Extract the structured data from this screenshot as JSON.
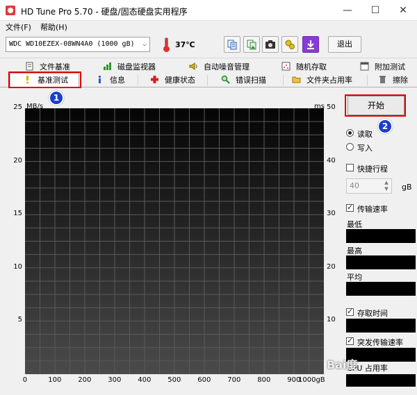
{
  "window": {
    "title": "HD Tune Pro 5.70 - 硬盘/固态硬盘实用程序",
    "minimize": "—",
    "maximize": "☐",
    "close": "✕"
  },
  "menu": {
    "file": "文件(F)",
    "help": "帮助(H)"
  },
  "toolbar": {
    "drive": "WDC WD10EZEX-08WN4A0 (1000 gB)",
    "temperature": "37℃",
    "exit_label": "退出",
    "buttons": [
      "copy-text-icon",
      "copy-image-icon",
      "screenshot-icon",
      "options-icon",
      "download-icon"
    ]
  },
  "tabs": {
    "row1": [
      "文件基准",
      "磁盘监视器",
      "自动噪音管理",
      "随机存取",
      "附加测试"
    ],
    "row2": [
      "基准测试",
      "信息",
      "健康状态",
      "错误扫描",
      "文件夹占用率",
      "擦除"
    ],
    "active": "基准测试"
  },
  "chart_data": {
    "type": "line",
    "ylabel_left": "MB/s",
    "ylabel_right": "ms",
    "xlabel_unit": "gB",
    "ylim_left": [
      0,
      25
    ],
    "ylim_right": [
      0,
      50
    ],
    "xlim": [
      0,
      1000
    ],
    "y_ticks_left": [
      "25",
      "20",
      "15",
      "10",
      "5"
    ],
    "y_ticks_right": [
      "50",
      "40",
      "30",
      "20",
      "10"
    ],
    "x_ticks": [
      "0",
      "100",
      "200",
      "300",
      "400",
      "500",
      "600",
      "700",
      "800",
      "900",
      "1000gB"
    ],
    "series": [],
    "grid": true
  },
  "right_panel": {
    "start_label": "开始",
    "read_label": "读取",
    "write_label": "写入",
    "short_stroke_label": "快捷行程",
    "short_stroke_value": "40",
    "short_stroke_unit": "gB",
    "transfer_rate_label": "传输速率",
    "min_label": "最低",
    "max_label": "最高",
    "avg_label": "平均",
    "access_time_label": "存取时间",
    "burst_rate_label": "突发传输速率",
    "cpu_label": "CPU 占用率"
  },
  "annotations": {
    "badge1": "1",
    "badge2": "2"
  },
  "watermark": "Bai度"
}
